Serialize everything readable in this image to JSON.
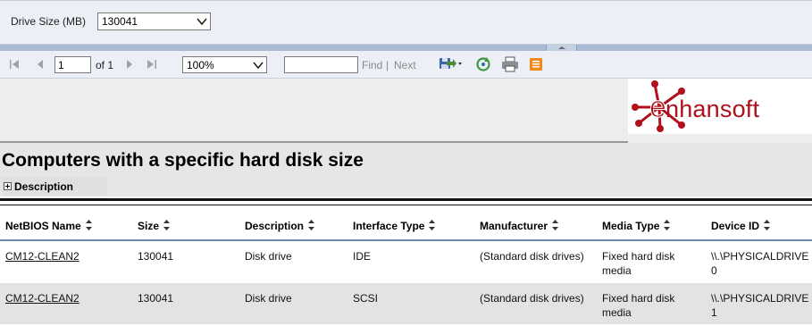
{
  "parameters": {
    "drive_size_label": "Drive Size (MB)",
    "drive_size_value": "130041"
  },
  "toolbar": {
    "page_current": "1",
    "page_of": "of 1",
    "zoom_value": "100%",
    "find_value": "",
    "find_label": "Find",
    "separator": "|",
    "next_label": "Next",
    "icons": [
      "first-page-icon",
      "previous-page-icon",
      "next-page-icon",
      "last-page-icon",
      "export-icon",
      "refresh-icon",
      "print-icon",
      "data-feed-icon"
    ]
  },
  "logo": {
    "text": "nhansoft",
    "brand_color": "#b0101c"
  },
  "report": {
    "title": "Computers with a specific hard disk size",
    "description_toggle": "Description",
    "columns": [
      "NetBIOS Name",
      "Size",
      "Description",
      "Interface Type",
      "Manufacturer",
      "Media Type",
      "Device ID"
    ],
    "rows": [
      {
        "netbios": "CM12-CLEAN2",
        "size": "130041",
        "description": "Disk drive",
        "interface": "IDE",
        "manufacturer": "(Standard disk drives)",
        "media": "Fixed hard disk media",
        "device_id": "\\\\.\\PHYSICALDRIVE0"
      },
      {
        "netbios": "CM12-CLEAN2",
        "size": "130041",
        "description": "Disk drive",
        "interface": "SCSI",
        "manufacturer": "(Standard disk drives)",
        "media": "Fixed hard disk media",
        "device_id": "\\\\.\\PHYSICALDRIVE1"
      }
    ]
  }
}
